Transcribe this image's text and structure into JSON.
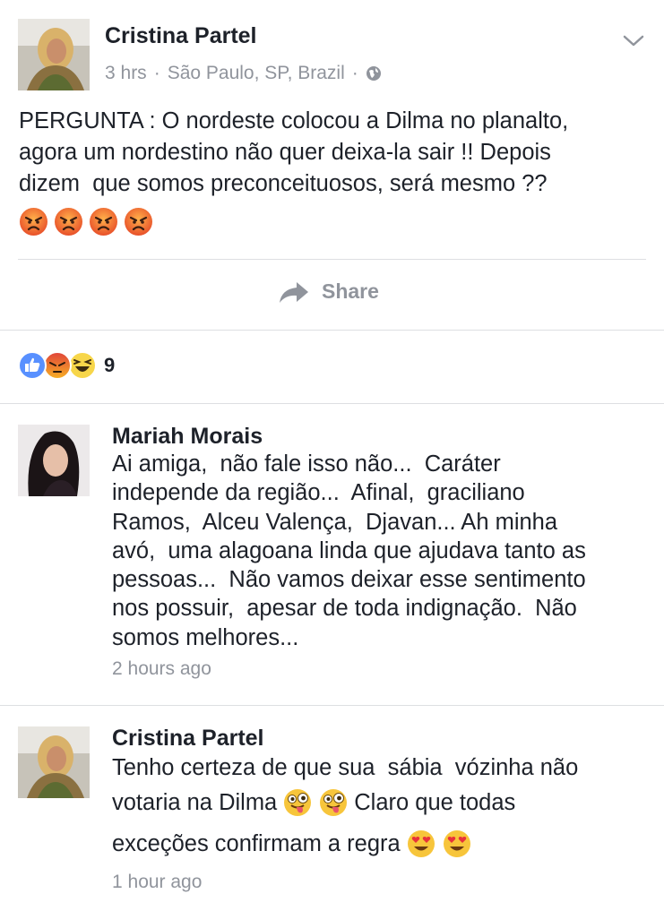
{
  "post": {
    "author": "Cristina Partel",
    "time": "3 hrs",
    "location": "São Paulo, SP, Brazil",
    "privacy_icon": "globe-icon",
    "text": "PERGUNTA : O nordeste colocou a Dilma no planalto,\nagora um nordestino não quer deixa-la sair !! Depois\ndizem  que somos preconceituosos, será mesmo ??",
    "emojis": [
      "angry-face",
      "angry-face",
      "angry-face",
      "angry-face"
    ],
    "share_label": "Share",
    "reaction_icons": [
      "like-icon",
      "angry-icon",
      "haha-icon"
    ],
    "reaction_count": "9"
  },
  "comments": [
    {
      "author": "Mariah Morais",
      "text": "Ai amiga,  não fale isso não...  Caráter\nindepende da região...  Afinal,  graciliano\nRamos,  Alceu Valença,  Djavan... Ah minha\navó,  uma alagoana linda que ajudava tanto as\npessoas...  Não vamos deixar esse sentimento\nnos possuir,  apesar de toda indignação.  Não\nsomos melhores...",
      "time": "2 hours ago"
    },
    {
      "author": "Cristina Partel",
      "text_part1": "Tenho certeza de que sua  sábia  vózinha não",
      "text_part2": "votaria na Dilma",
      "text_part3": "Claro que todas",
      "text_part4": "exceções confirmam a regra",
      "time": "1 hour ago"
    }
  ],
  "colors": {
    "text": "#1d2129",
    "secondary": "#90949c",
    "divider": "#dddfe2",
    "like_blue": "#5890ff"
  }
}
